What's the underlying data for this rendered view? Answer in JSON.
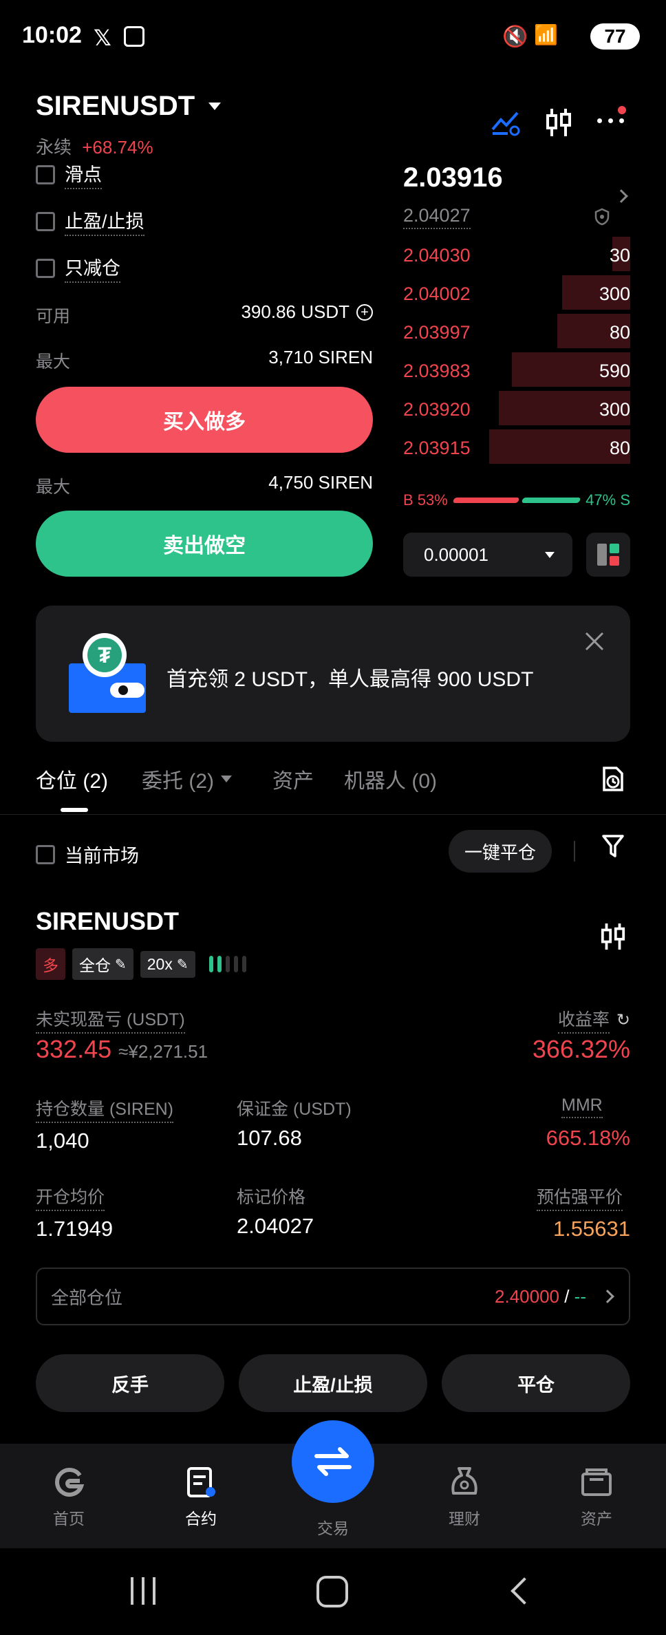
{
  "status_bar": {
    "time": "10:02",
    "battery": "77"
  },
  "header": {
    "symbol": "SIRENUSDT",
    "contract_type": "永续",
    "change": "+68.74%"
  },
  "options": {
    "slippage": "滑点",
    "tpsl": "止盈/止损",
    "reduce_only": "只减仓"
  },
  "available": {
    "label": "可用",
    "value": "390.86 USDT"
  },
  "buy": {
    "max_label": "最大",
    "max_value": "3,710 SIREN",
    "button": "买入做多"
  },
  "sell": {
    "max_label": "最大",
    "max_value": "4,750 SIREN",
    "button": "卖出做空"
  },
  "orderbook": {
    "last_price": "2.03916",
    "mark_price": "2.04027",
    "asks": [
      {
        "price": "2.04030",
        "qty": "30",
        "depth": 0.08
      },
      {
        "price": "2.04002",
        "qty": "300",
        "depth": 0.3
      },
      {
        "price": "2.03997",
        "qty": "80",
        "depth": 0.32
      },
      {
        "price": "2.03983",
        "qty": "590",
        "depth": 0.52
      },
      {
        "price": "2.03920",
        "qty": "300",
        "depth": 0.58
      },
      {
        "price": "2.03915",
        "qty": "80",
        "depth": 0.62
      }
    ],
    "buy_ratio": "B 53%",
    "sell_ratio": "47% S",
    "buy_fraction": 0.53,
    "precision": "0.00001"
  },
  "promo": {
    "text": "首充领 2 USDT，单人最高得 900 USDT"
  },
  "tabs": [
    {
      "label": "仓位 (2)"
    },
    {
      "label": "委托 (2)"
    },
    {
      "label": "资产"
    },
    {
      "label": "机器人 (0)"
    }
  ],
  "filter": {
    "current_market": "当前市场",
    "close_all": "一键平仓"
  },
  "position": {
    "symbol": "SIRENUSDT",
    "side": "多",
    "margin_mode": "全仓",
    "leverage": "20x",
    "unrealized_label": "未实现盈亏 (USDT)",
    "unrealized_value": "332.45",
    "unrealized_cny": "≈¥2,271.51",
    "roi_label": "收益率",
    "roi_value": "366.32%",
    "qty_label": "持仓数量 (SIREN)",
    "qty_value": "1,040",
    "margin_label": "保证金 (USDT)",
    "margin_value": "107.68",
    "mmr_label": "MMR",
    "mmr_value": "665.18%",
    "entry_label": "开仓均价",
    "entry_value": "1.71949",
    "mark_label": "标记价格",
    "mark_value": "2.04027",
    "liq_label": "预估强平价",
    "liq_value": "1.55631",
    "all_positions_label": "全部仓位",
    "all_positions_tp": "2.40000",
    "all_positions_sep": " / ",
    "all_positions_sl": "--",
    "btn_reverse": "反手",
    "btn_tpsl": "止盈/止损",
    "btn_close": "平仓"
  },
  "bottom_nav": [
    {
      "label": "首页"
    },
    {
      "label": "合约"
    },
    {
      "label": "交易"
    },
    {
      "label": "理财"
    },
    {
      "label": "资产"
    }
  ],
  "colors": {
    "red": "#f0454e",
    "green": "#2fc38c",
    "blue": "#1a6dff",
    "orange": "#f7a35c"
  }
}
